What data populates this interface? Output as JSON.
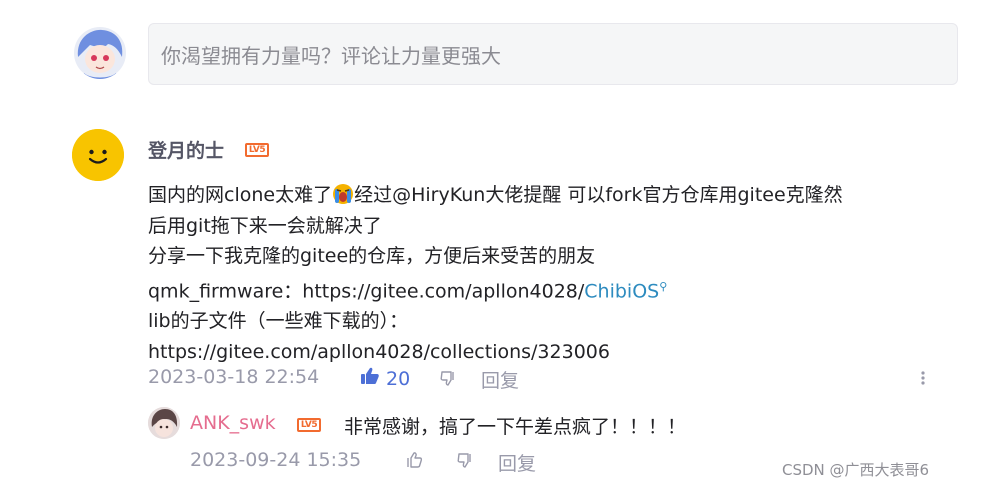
{
  "input": {
    "placeholder": "你渴望拥有力量吗？评论让力量更强大"
  },
  "comment": {
    "username": "登月的士",
    "level_badge": "LV5",
    "lines": [
      {
        "pre": "国内的网clone太难了",
        "post": "经过@HiryKun大佬提醒 可以fork官方仓库用gitee克隆然"
      },
      {
        "text": "后用git拖下来一会就解决了"
      },
      {
        "text": "分享一下我克隆的gitee的仓库，方便后来受苦的朋友"
      },
      {
        "pre": "qmk_firmware：https://gitee.com/apllon4028/",
        "link": "ChibiOS"
      },
      {
        "text": "lib的子文件（一些难下载的）："
      },
      {
        "text": "https://gitee.com/apllon4028/collections/323006"
      }
    ],
    "time": "2023-03-18 22:54",
    "likes": "20",
    "reply_label": "回复"
  },
  "reply": {
    "username": "ANK_swk",
    "level_badge": "LV5",
    "text": "非常感谢，搞了一下午差点疯了！！！！",
    "time": "2023-09-24 15:35",
    "reply_label": "回复"
  },
  "watermark": "CSDN @广西大表哥6",
  "colors": {
    "accent": "#4d6fd6",
    "badge": "#f26b2f",
    "link": "#2d8bbf",
    "reply_user": "#e56d8f"
  },
  "icons": [
    "anime-avatar",
    "smiley-avatar",
    "crying-emoji",
    "thumbs-up-icon",
    "thumbs-down-icon",
    "more-icon",
    "search-icon"
  ]
}
